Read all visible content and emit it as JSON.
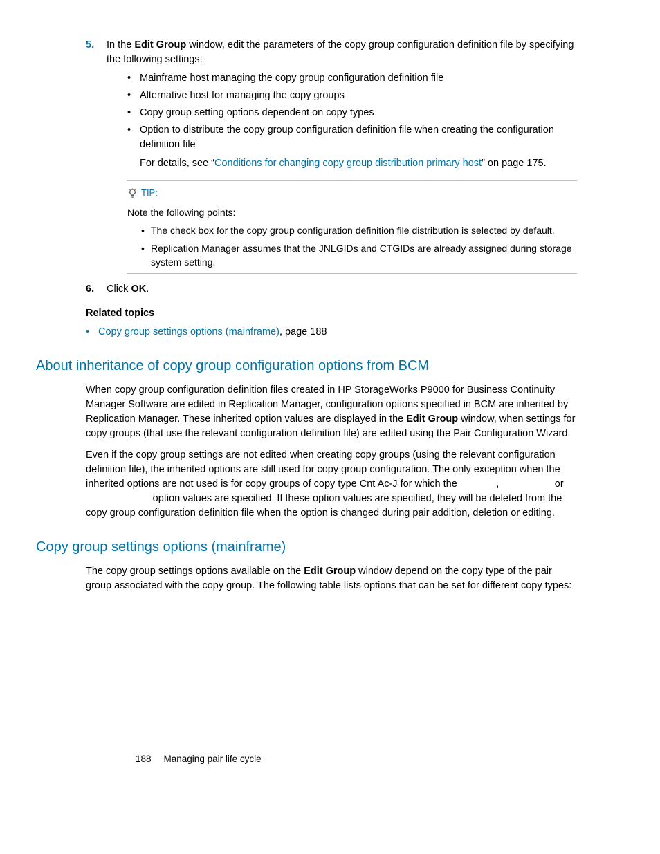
{
  "step5": {
    "num": "5.",
    "lead1": "In the ",
    "bold1": "Edit Group",
    "lead2": " window, edit the parameters of the copy group configuration definition file by specifying the following settings:",
    "bullets": [
      "Mainframe host managing the copy group configuration definition file",
      "Alternative host for managing the copy groups",
      "Copy group setting options dependent on copy types"
    ],
    "bullet4a": "Option to distribute the copy group configuration definition file when creating the configuration definition file",
    "bullet4b_pre": "For details, see “",
    "bullet4b_link": "Conditions for changing copy group distribution primary host",
    "bullet4b_post": "” on page 175."
  },
  "tip": {
    "label": "TIP:",
    "intro": "Note the following points:",
    "items": [
      "The check box for the copy group configuration definition file distribution is selected by default.",
      "Replication Manager assumes that the JNLGIDs and CTGIDs are already assigned during storage system setting."
    ]
  },
  "step6": {
    "num": "6.",
    "pre": "Click ",
    "bold": "OK",
    "post": "."
  },
  "related": {
    "heading": "Related topics",
    "link": "Copy group settings options (mainframe)",
    "suffix": ", page 188"
  },
  "sec1": {
    "heading": "About inheritance of copy group configuration options from BCM",
    "p1a": "When copy group configuration definition files created in HP StorageWorks P9000 for Business Continuity Manager Software are edited in Replication Manager, configuration options specified in BCM are inherited by Replication Manager. These inherited option values are displayed in the ",
    "p1b": "Edit Group",
    "p1c": " window, when settings for copy groups (that use the relevant configuration definition file) are edited using the Pair Configuration Wizard.",
    "p2": "Even if the copy group settings are not edited when creating copy groups (using the relevant configuration definition file), the inherited options are still used for copy group configuration. The only exception when the inherited options are not used is for copy groups of copy type Cnt Ac-J for which the              ,                    or                         option values are specified. If these option values are specified, they will be deleted from the copy group configuration definition file when the option is changed during pair addition, deletion or editing."
  },
  "sec2": {
    "heading": "Copy group settings options (mainframe)",
    "p1a": "The copy group settings options available on the ",
    "p1b": "Edit Group",
    "p1c": " window depend on the copy type of the pair group associated with the copy group. The following table lists options that can be set for different copy types:"
  },
  "footer": {
    "page": "188",
    "label": "Managing pair life cycle"
  }
}
